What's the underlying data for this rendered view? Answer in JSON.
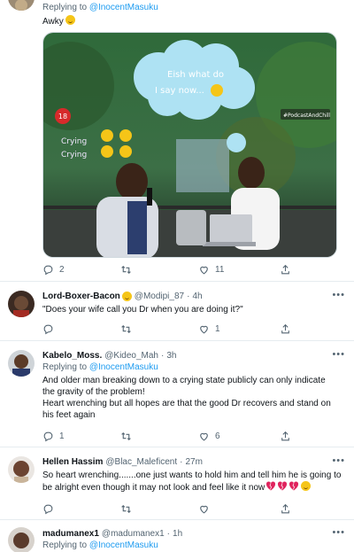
{
  "tweet1": {
    "reply_prefix": "Replying to",
    "reply_handle": "@InocentMasuku",
    "text": "Awky",
    "media": {
      "cloud_text_line1": "Eish what do",
      "cloud_text_line2": "I say now...",
      "age_badge": "18",
      "crying_line1": "Crying",
      "crying_line2": "Crying",
      "channel_tag": "#PodcastAndChill"
    },
    "replies": "2",
    "likes": "11"
  },
  "tweet2": {
    "name": "Lord-Boxer-Bacon",
    "handle": "@Modipi_87",
    "time": "4h",
    "text": "\"Does your wife call you Dr when you are doing it?\"",
    "likes": "1"
  },
  "tweet3": {
    "name": "Kabelo_Moss.",
    "handle": "@Kideo_Mah",
    "time": "3h",
    "reply_prefix": "Replying to",
    "reply_handle": "@InocentMasuku",
    "text_line1": "And older man breaking down to a crying state publicly can only indicate",
    "text_line2": "the gravity of the problem!",
    "text_line3": "Heart wrenching but all hopes are that the good Dr recovers and stand on",
    "text_line4": "his feet again",
    "replies": "1",
    "likes": "6"
  },
  "tweet4": {
    "name": "Hellen Hassim",
    "handle": "@Blac_Maleficent",
    "time": "27m",
    "text_line1": "So heart wrenching.......one just wants to hold him and tell him he is going to",
    "text_line2": "be alright even though it may not look and feel like it now"
  },
  "tweet5": {
    "name": "madumanex1",
    "handle": "@madumanex1",
    "time": "1h",
    "reply_prefix": "Replying to",
    "reply_handle": "@InocentMasuku"
  },
  "colors": {
    "accent": "#1d9bf0",
    "secondary_text": "#536471",
    "divider": "#e6ecf0",
    "broken_heart": "#e0245e"
  }
}
